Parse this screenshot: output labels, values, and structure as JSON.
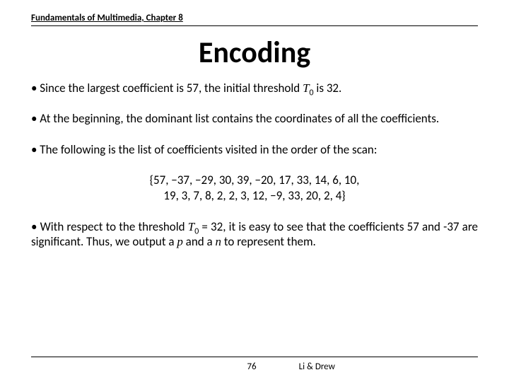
{
  "header": {
    "chapter": "Fundamentals of Multimedia, Chapter 8"
  },
  "title": "Encoding",
  "bullets": {
    "b1_pre": "• Since the largest coefficient is 57, the initial threshold ",
    "b1_sym": "T",
    "b1_sub": "0",
    "b1_post": " is 32.",
    "b2": "• At the beginning, the dominant list contains the coordinates of all the coefficients.",
    "b3": "• The following is the list of coefficients visited in the order of the scan:",
    "list_l1": "{57, −37, −29, 30, 39, −20, 17, 33, 14, 6, 10,",
    "list_l2": "19, 3, 7, 8, 2, 2, 3, 12, −9, 33, 20, 2, 4}",
    "b4_pre": "• With respect to the threshold ",
    "b4_sym": "T",
    "b4_sub": "0",
    "b4_mid": " = 32, it is easy to see that the coefficients 57 and -37 are significant. Thus, we output a ",
    "b4_p": "p",
    "b4_and": " and a ",
    "b4_n": "n",
    "b4_post": " to represent them."
  },
  "footer": {
    "page": "76",
    "authors": "Li & Drew"
  }
}
